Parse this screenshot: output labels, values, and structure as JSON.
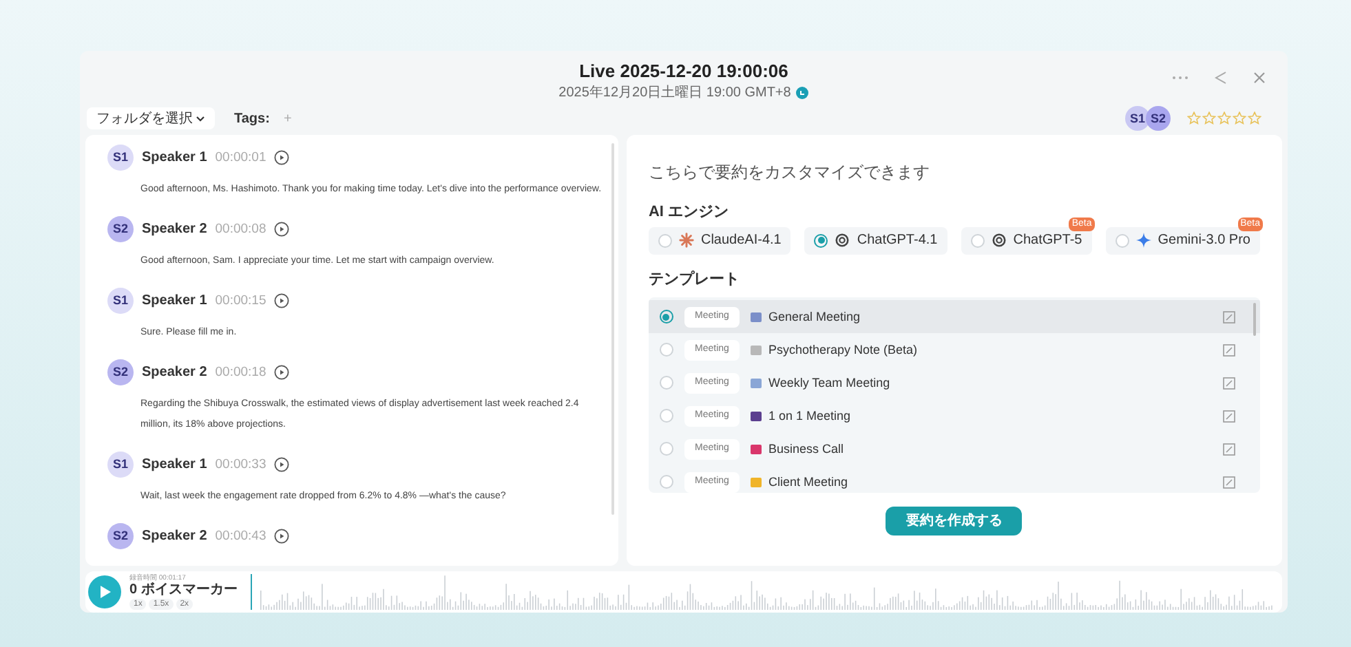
{
  "header": {
    "title": "Live 2025-12-20 19:00:06",
    "subtitle": "2025年12月20日土曜日 19:00 GMT+8"
  },
  "toolbar": {
    "folder": "フォルダを選択",
    "tags_label": "Tags:",
    "add_tag": "+",
    "speakers": [
      {
        "label": "S1",
        "color": "#c9c8f3"
      },
      {
        "label": "S2",
        "color": "#a9a6ee"
      }
    ],
    "stars": 0
  },
  "transcript": [
    {
      "badge": "S1",
      "color": "#dcdbf7",
      "speaker": "Speaker 1",
      "time": "00:00:01",
      "text": "Good afternoon, Ms. Hashimoto. Thank you for making time today. Let's dive into the performance overview."
    },
    {
      "badge": "S2",
      "color": "#b9b6f0",
      "speaker": "Speaker 2",
      "time": "00:00:08",
      "text": "Good afternoon, Sam. I appreciate your time. Let me start with campaign overview."
    },
    {
      "badge": "S1",
      "color": "#dcdbf7",
      "speaker": "Speaker 1",
      "time": "00:00:15",
      "text": "Sure. Please fill me in."
    },
    {
      "badge": "S2",
      "color": "#b9b6f0",
      "speaker": "Speaker 2",
      "time": "00:00:18",
      "text": "Regarding the Shibuya Crosswalk, the estimated views of display advertisement last week reached 2.4 million, its 18% above projections."
    },
    {
      "badge": "S1",
      "color": "#dcdbf7",
      "speaker": "Speaker 1",
      "time": "00:00:33",
      "text": "Wait, last week the engagement rate dropped from 6.2% to 4.8% —what's the cause?"
    },
    {
      "badge": "S2",
      "color": "#b9b6f0",
      "speaker": "Speaker 2",
      "time": "00:00:43"
    }
  ],
  "summary": {
    "heading": "こちらで要約をカスタマイズできます",
    "engine_label": "AI エンジン",
    "engines": [
      {
        "kind": "claude",
        "name": "ClaudeAI-4.1",
        "selected": false
      },
      {
        "kind": "gpt",
        "name": "ChatGPT-4.1",
        "selected": true
      },
      {
        "kind": "gpt",
        "name": "ChatGPT-5",
        "selected": false,
        "badge": "Beta"
      },
      {
        "kind": "gemini",
        "name": "Gemini-3.0 Pro",
        "selected": false,
        "badge": "Beta"
      }
    ],
    "template_label": "テンプレート",
    "templates": [
      {
        "tag": "Meeting",
        "name": "General Meeting",
        "color": "#7b8fc9",
        "selected": true
      },
      {
        "tag": "Meeting",
        "name": "Psychotherapy Note (Beta)",
        "color": "#b8b8b8",
        "selected": false
      },
      {
        "tag": "Meeting",
        "name": "Weekly Team Meeting",
        "color": "#8aa6d6",
        "selected": false
      },
      {
        "tag": "Meeting",
        "name": "1 on 1 Meeting",
        "color": "#5b3f8f",
        "selected": false
      },
      {
        "tag": "Meeting",
        "name": "Business Call",
        "color": "#d9366b",
        "selected": false
      },
      {
        "tag": "Meeting",
        "name": "Client Meeting",
        "color": "#f0b429",
        "selected": false
      }
    ],
    "create_button": "要約を作成する"
  },
  "player": {
    "duration": "録音時間 00:01:17",
    "markers": "0 ボイスマーカー",
    "speeds": [
      "1x",
      "1.5x",
      "2x"
    ]
  }
}
